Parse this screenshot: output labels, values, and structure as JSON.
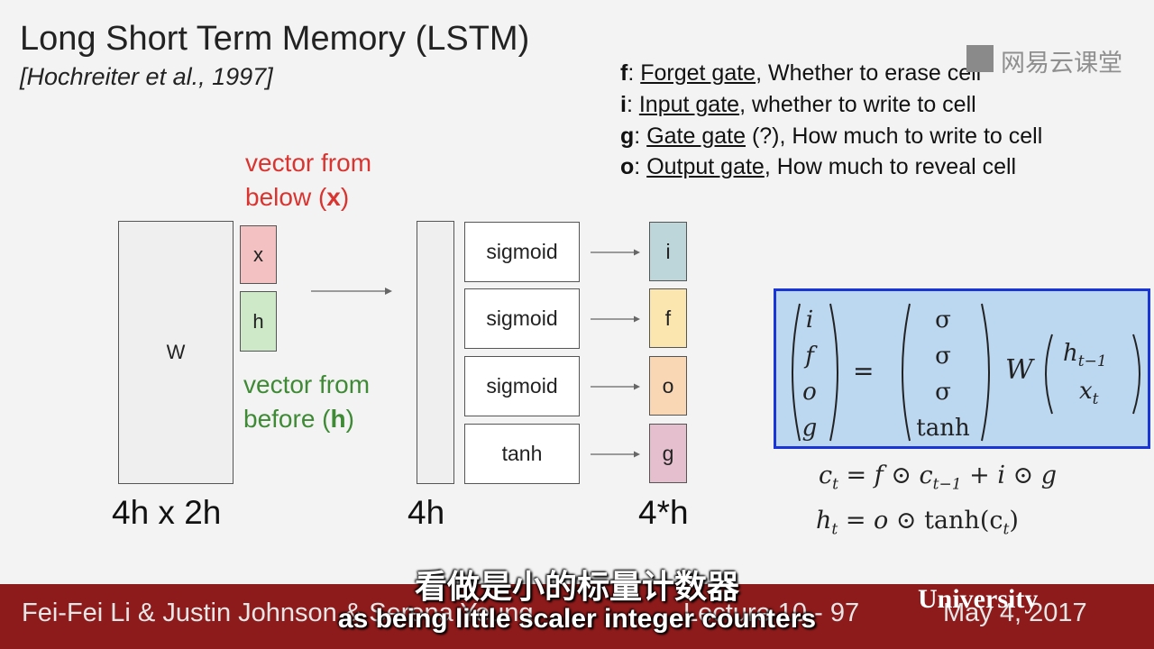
{
  "slide": {
    "title": "Long Short Term Memory (LSTM)",
    "citation": "[Hochreiter et al., 1997]"
  },
  "gates": [
    {
      "letter": "f",
      "name": "Forget gate",
      "desc": ", Whether to erase cell"
    },
    {
      "letter": "i",
      "name": "Input gate",
      "desc": ", whether to write to cell"
    },
    {
      "letter": "g",
      "name": "Gate gate",
      "desc": " (?), How much to write to cell"
    },
    {
      "letter": "o",
      "name": "Output gate",
      "desc": ", How much to reveal cell"
    }
  ],
  "watermark": {
    "text": "网易云课堂"
  },
  "diagram": {
    "w_label": "W",
    "x_label": "x",
    "h_label": "h",
    "vector_below_line1": "vector from",
    "vector_below_line2_pre": "below (",
    "vector_below_var": "x",
    "vector_below_line2_post": ")",
    "vector_before_line1": "vector from",
    "vector_before_line2_pre": "before (",
    "vector_before_var": "h",
    "vector_before_line2_post": ")",
    "w_dims": "4h x 2h",
    "col_dims": "4h",
    "out_dims": "4*h",
    "activations": [
      "sigmoid",
      "sigmoid",
      "sigmoid",
      "tanh"
    ],
    "outputs": [
      "i",
      "f",
      "o",
      "g"
    ]
  },
  "colors": {
    "out_i": "#bcd6da",
    "out_f": "#fbe6b0",
    "out_o": "#f9d7b5",
    "out_g": "#e6bfcf",
    "x_box": "#f3c1c1",
    "h_box": "#cde9c8",
    "eq_box": "#bcd7f0",
    "eq_border": "#1a35d6",
    "footer": "#8d1b1b"
  },
  "equation": {
    "lhs": [
      "i",
      "f",
      "o",
      "g"
    ],
    "acts": [
      "σ",
      "σ",
      "σ",
      "tanh"
    ],
    "eq": "=",
    "w": "W",
    "vec_top_base": "h",
    "vec_top_sub": "t−1",
    "vec_bot_base": "x",
    "vec_bot_sub": "t"
  },
  "cell_eq": {
    "ct_lhs": "c",
    "ct_sub": "t",
    "ct_rhs_a": " = f ⊙ c",
    "ct_rhs_sub": "t−1",
    "ct_rhs_b": " + i ⊙ g",
    "ht_lhs": "h",
    "ht_sub": "t",
    "ht_rhs_a": " = o ⊙ ",
    "ht_tanh": "tanh",
    "ht_rhs_b": "(c",
    "ht_rhs_sub": "t",
    "ht_rhs_c": ")"
  },
  "footer": {
    "authors": "Fei-Fei Li & Justin Johnson & Serena Yeung",
    "lecture": "Lecture 10 - 97",
    "date": "May 4, 2017",
    "overlay": "University"
  },
  "subtitles": {
    "chinese": "看做是小的标量计数器",
    "english": "as being little scaler integer counters"
  }
}
